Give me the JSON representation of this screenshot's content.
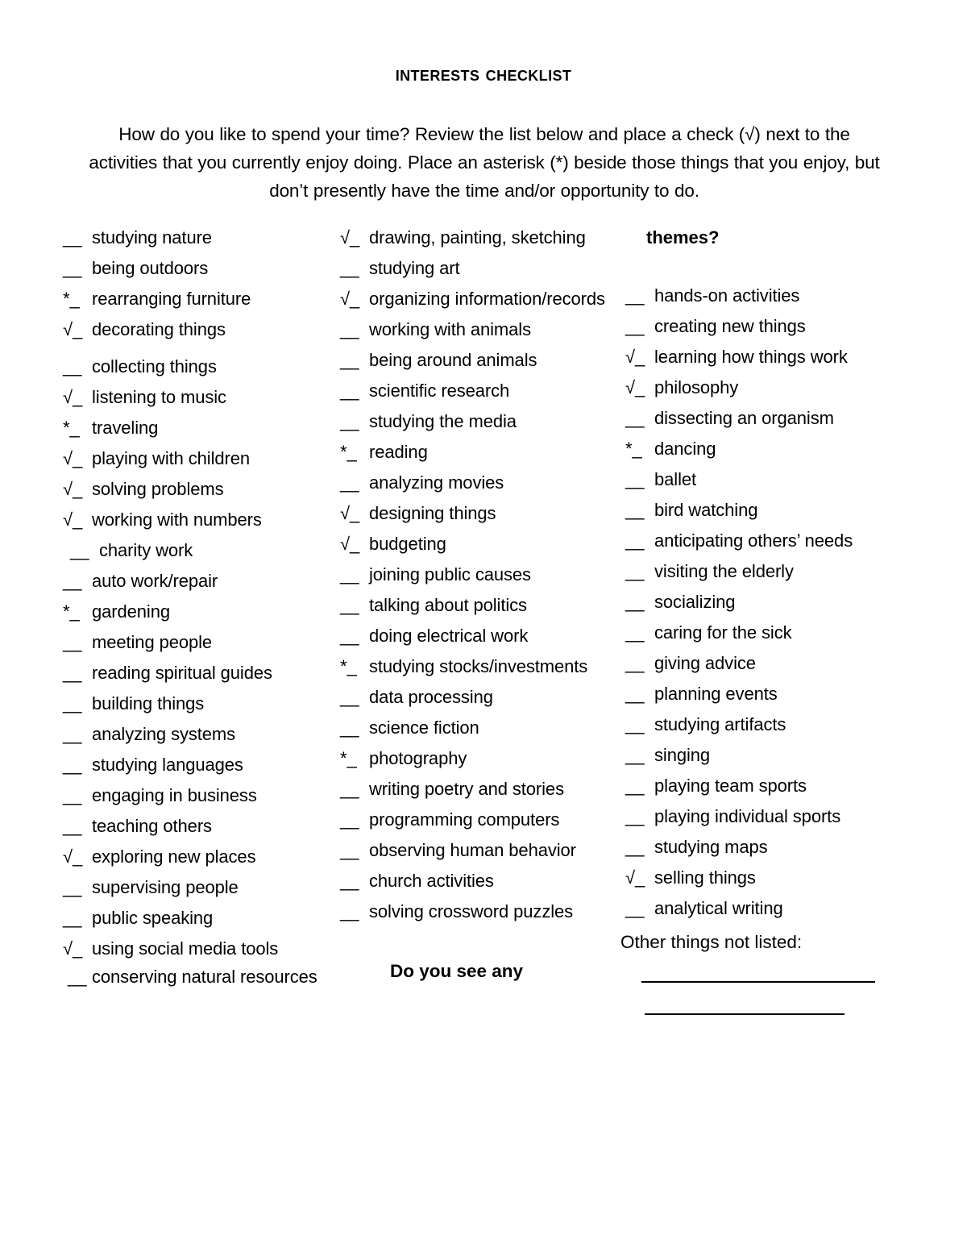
{
  "document": {
    "title": "Interests Checklist",
    "intro": "How do you like to spend your time? Review the list below and place a check (√) next to the  activities that you currently enjoy doing. Place an asterisk (*) beside those things that you enjoy, but  don’t presently have the time and/or opportunity to do."
  },
  "markers": {
    "blank": "__",
    "check": "√_",
    "asterisk": "*_"
  },
  "column1": {
    "items": [
      {
        "mark": "__",
        "label": "studying nature"
      },
      {
        "mark": "__",
        "label": "being outdoors"
      },
      {
        "mark": "*_",
        "label": "rearranging furniture"
      },
      {
        "mark": "√_",
        "label": "decorating things"
      },
      {
        "mark": "__",
        "label": "collecting things"
      },
      {
        "mark": "√_",
        "label": "listening to music"
      },
      {
        "mark": "*_",
        "label": "traveling"
      },
      {
        "mark": "√_",
        "label": "playing with children"
      },
      {
        "mark": "√_",
        "label": "solving problems"
      },
      {
        "mark": "√_",
        "label": "working with numbers"
      },
      {
        "mark": "__",
        "label": "charity work"
      },
      {
        "mark": "__",
        "label": "auto work/repair"
      },
      {
        "mark": "*_",
        "label": "gardening"
      },
      {
        "mark": "__",
        "label": "meeting people"
      },
      {
        "mark": "__",
        "label": "reading spiritual guides"
      },
      {
        "mark": "__",
        "label": "building things"
      },
      {
        "mark": "__",
        "label": "analyzing systems"
      },
      {
        "mark": "__",
        "label": "studying languages"
      },
      {
        "mark": "__",
        "label": "engaging in business"
      },
      {
        "mark": "__",
        "label": "teaching others"
      },
      {
        "mark": "√_",
        "label": "exploring new places"
      },
      {
        "mark": "__",
        "label": "supervising people"
      },
      {
        "mark": "__",
        "label": "public speaking"
      },
      {
        "mark": "√_",
        "label": "using social media tools"
      },
      {
        "mark": "__",
        "label": "conserving natural resources"
      }
    ]
  },
  "column2": {
    "items": [
      {
        "mark": "√_",
        "label": "drawing, painting, sketching"
      },
      {
        "mark": "__",
        "label": "studying art"
      },
      {
        "mark": "√_",
        "label": "organizing information/records"
      },
      {
        "mark": "__",
        "label": "working with animals"
      },
      {
        "mark": "__",
        "label": "being around animals"
      },
      {
        "mark": "__",
        "label": "scientific research"
      },
      {
        "mark": "__",
        "label": "studying the media"
      },
      {
        "mark": "*_",
        "label": "reading"
      },
      {
        "mark": "__",
        "label": "analyzing movies"
      },
      {
        "mark": "√_",
        "label": "designing things"
      },
      {
        "mark": "√_",
        "label": "budgeting"
      },
      {
        "mark": "__",
        "label": "joining public causes"
      },
      {
        "mark": "__",
        "label": "talking about politics"
      },
      {
        "mark": "__",
        "label": "doing electrical work"
      },
      {
        "mark": "*_",
        "label": "studying stocks/investments"
      },
      {
        "mark": "__",
        "label": "data processing"
      },
      {
        "mark": "__",
        "label": "science fiction"
      },
      {
        "mark": "*_",
        "label": "photography"
      },
      {
        "mark": "__",
        "label": "writing poetry and stories"
      },
      {
        "mark": "__",
        "label": "programming computers"
      },
      {
        "mark": "__",
        "label": "observing human behavior"
      },
      {
        "mark": "__",
        "label": "church activities"
      },
      {
        "mark": "__",
        "label": "solving crossword puzzles"
      }
    ],
    "question": "Do you see any"
  },
  "column3": {
    "heading": "themes?",
    "items": [
      {
        "mark": "__",
        "label": "hands-on activities"
      },
      {
        "mark": "__",
        "label": "creating new things"
      },
      {
        "mark": "√_",
        "label": "learning how things work"
      },
      {
        "mark": "√_",
        "label": "philosophy"
      },
      {
        "mark": "__",
        "label": "dissecting an organism"
      },
      {
        "mark": "*_",
        "label": "dancing"
      },
      {
        "mark": "__",
        "label": "ballet"
      },
      {
        "mark": "__",
        "label": "bird watching"
      },
      {
        "mark": "__",
        "label": "anticipating others’ needs"
      },
      {
        "mark": "__",
        "label": "visiting the elderly"
      },
      {
        "mark": "__",
        "label": "socializing"
      },
      {
        "mark": "__",
        "label": "caring for the sick"
      },
      {
        "mark": "__",
        "label": "giving advice"
      },
      {
        "mark": "__",
        "label": "planning events"
      },
      {
        "mark": "__",
        "label": "studying artifacts"
      },
      {
        "mark": "__",
        "label": "singing"
      },
      {
        "mark": "__",
        "label": "playing team sports"
      },
      {
        "mark": "__",
        "label": "playing individual sports"
      },
      {
        "mark": "__",
        "label": "studying maps"
      },
      {
        "mark": "√_",
        "label": "selling things"
      },
      {
        "mark": "__",
        "label": "analytical writing"
      }
    ],
    "other_label": "Other things not listed:",
    "blank_lines": 2
  }
}
